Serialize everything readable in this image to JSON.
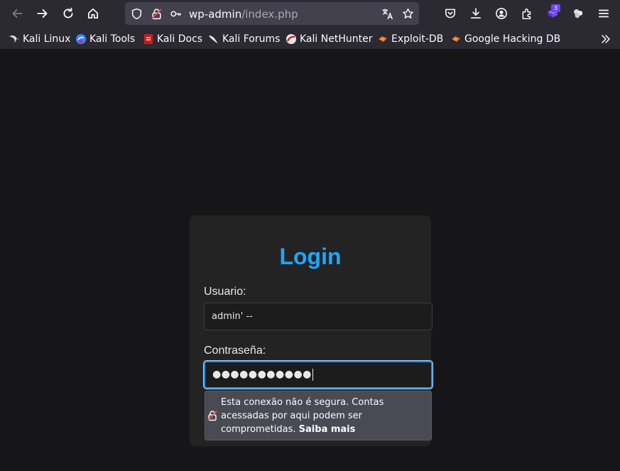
{
  "toolbar": {
    "icons": [
      "back-arrow-icon",
      "forward-arrow-icon",
      "reload-icon",
      "home-icon",
      "shield-icon",
      "insecure-lock-icon",
      "key-icon",
      "translate-icon",
      "star-icon",
      "pocket-icon",
      "download-icon",
      "account-icon",
      "extensions-icon",
      "extension-badge-icon",
      "extension-icon",
      "menu-icon"
    ],
    "url_host": "wp-admin",
    "url_path": "/index.php",
    "badge_count": "3"
  },
  "bookmarks": [
    {
      "label": "Kali Linux",
      "icon": "kali-dragon-icon"
    },
    {
      "label": "Kali Tools",
      "icon": "kali-tools-icon"
    },
    {
      "label": "Kali Docs",
      "icon": "kali-docs-icon"
    },
    {
      "label": "Kali Forums",
      "icon": "kali-forums-icon"
    },
    {
      "label": "Kali NetHunter",
      "icon": "nethunter-icon"
    },
    {
      "label": "Exploit-DB",
      "icon": "exploit-db-icon"
    },
    {
      "label": "Google Hacking DB",
      "icon": "ghdb-icon"
    }
  ],
  "login": {
    "title": "Login",
    "username_label": "Usuario:",
    "username_value": "admin' --",
    "password_label": "Contraseña:",
    "password_value": "●●●●●●●●●●●"
  },
  "insecure_popup": {
    "message": "Esta conexão não é segura. Contas acessadas por aqui podem ser comprometidas.",
    "link": "Saiba mais"
  },
  "colors": {
    "accent": "#1ea7ff",
    "focus_ring": "#1e90ff",
    "toolbar_bg": "#2b2a33",
    "page_bg": "#161618",
    "card_bg": "#232323"
  }
}
